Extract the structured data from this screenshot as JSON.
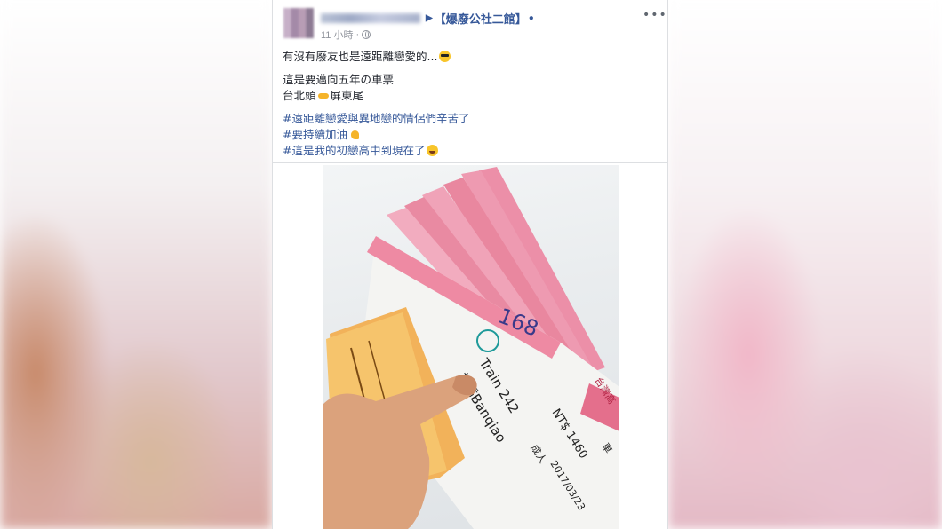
{
  "post": {
    "group_name": "【爆廢公社二館】",
    "timestamp": "11 小時",
    "separator": "·",
    "more_label": "•••",
    "text": {
      "line1": "有沒有廢友也是遠距離戀愛的...",
      "line2": "這是要邁向五年の車票",
      "line3_a": "台北頭",
      "line3_b": "屏東尾",
      "hashtag1": "#遠距離戀愛與異地戀的情侶們辛苦了",
      "hashtag2": "#要持續加油",
      "hashtag3": "#這是我的初戀高中到現在了"
    },
    "emojis": [
      "cool-face-emoji",
      "pointing-hand-emoji",
      "flexed-biceps-emoji",
      "laughing-face-emoji"
    ]
  },
  "photo": {
    "ticket_number": "168",
    "ticket_train": "Train 242",
    "ticket_station_zh": "板橋",
    "ticket_station_en": "Banqiao",
    "ticket_price": "NT$ 1460",
    "ticket_date": "2017/03/23",
    "ticket_adult": "成人",
    "ticket_brand": "台灣高",
    "ticket_car": "車"
  },
  "colors": {
    "link": "#365899",
    "text": "#1d2129",
    "meta": "#90949c",
    "ticket_pink": "#e9879f",
    "ticket_orange": "#f2b25a"
  }
}
